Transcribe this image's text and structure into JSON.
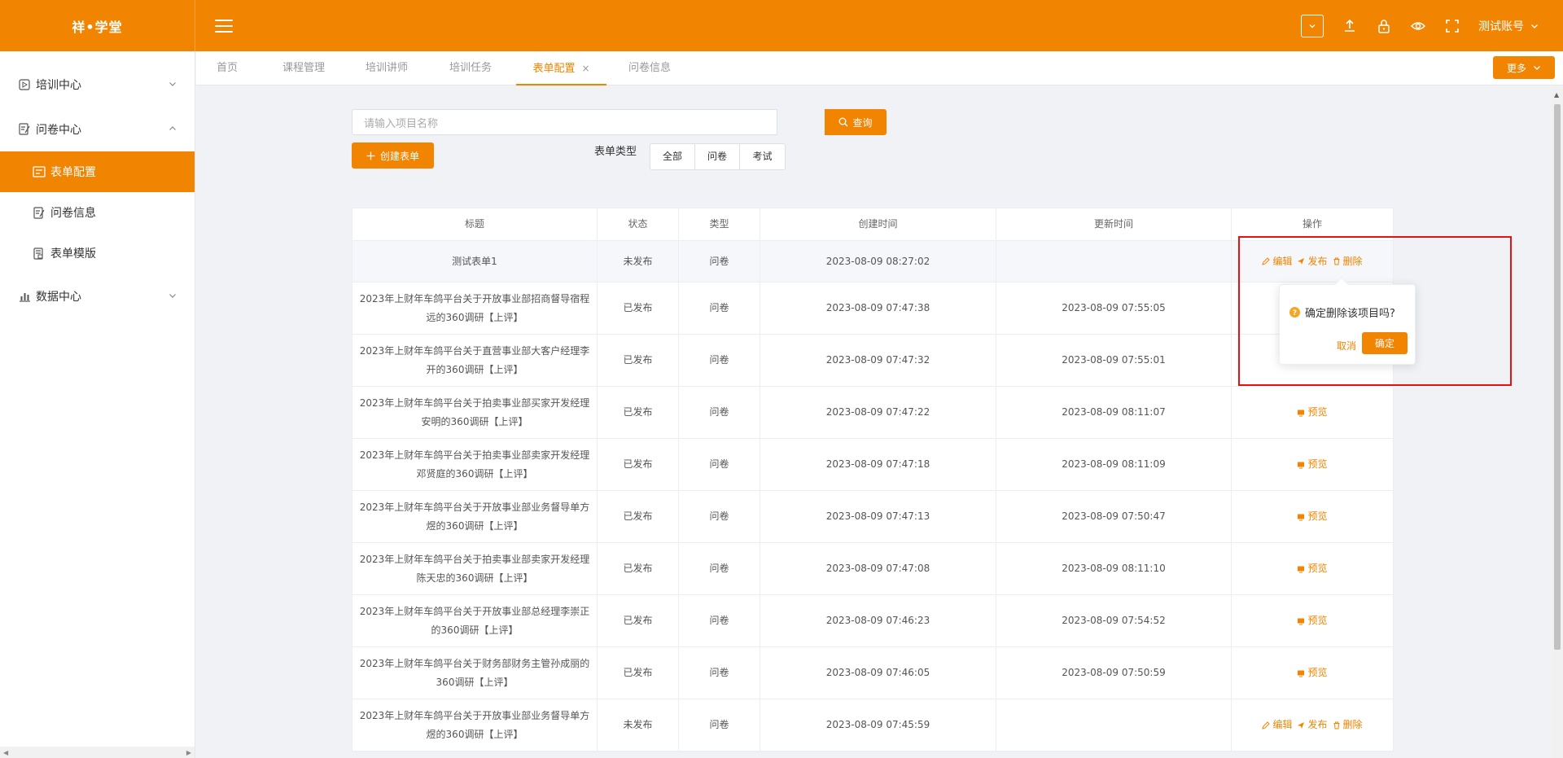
{
  "app": {
    "title": "祥•学堂"
  },
  "header": {
    "account_label": "测试账号"
  },
  "sidebar": {
    "groups": [
      {
        "label": "培训中心",
        "expanded": false
      },
      {
        "label": "问卷中心",
        "expanded": true
      },
      {
        "label": "数据中心",
        "expanded": false
      }
    ],
    "sub_items": [
      {
        "label": "表单配置",
        "active": true
      },
      {
        "label": "问卷信息",
        "active": false
      },
      {
        "label": "表单模版",
        "active": false
      }
    ]
  },
  "tabs": [
    {
      "label": "首页"
    },
    {
      "label": "课程管理"
    },
    {
      "label": "培训讲师"
    },
    {
      "label": "培训任务"
    },
    {
      "label": "表单配置",
      "active": true,
      "close": "×"
    },
    {
      "label": "问卷信息"
    }
  ],
  "more_button": {
    "label": "更多"
  },
  "search": {
    "placeholder": "请输入项目名称",
    "button_label": "查询"
  },
  "create_button": {
    "label": "创建表单"
  },
  "type_filter": {
    "label": "表单类型",
    "options": [
      "全部",
      "问卷",
      "考试"
    ]
  },
  "table": {
    "headers": [
      "标题",
      "状态",
      "类型",
      "创建时间",
      "更新时间",
      "操作"
    ],
    "rows": [
      {
        "title": "测试表单1",
        "status": "未发布",
        "type": "问卷",
        "created": "2023-08-09 08:27:02",
        "updated": "",
        "actions": [
          "编辑",
          "发布",
          "删除"
        ]
      },
      {
        "title": "2023年上财年车鸽平台关于开放事业部招商督导宿程远的360调研【上评】",
        "status": "已发布",
        "type": "问卷",
        "created": "2023-08-09 07:47:38",
        "updated": "2023-08-09 07:55:05",
        "actions": []
      },
      {
        "title": "2023年上财年车鸽平台关于直营事业部大客户经理李开的360调研【上评】",
        "status": "已发布",
        "type": "问卷",
        "created": "2023-08-09 07:47:32",
        "updated": "2023-08-09 07:55:01",
        "actions": []
      },
      {
        "title": "2023年上财年车鸽平台关于拍卖事业部买家开发经理安明的360调研【上评】",
        "status": "已发布",
        "type": "问卷",
        "created": "2023-08-09 07:47:22",
        "updated": "2023-08-09 08:11:07",
        "actions": [
          "预览"
        ]
      },
      {
        "title": "2023年上财年车鸽平台关于拍卖事业部卖家开发经理邓贤庭的360调研【上评】",
        "status": "已发布",
        "type": "问卷",
        "created": "2023-08-09 07:47:18",
        "updated": "2023-08-09 08:11:09",
        "actions": [
          "预览"
        ]
      },
      {
        "title": "2023年上财年车鸽平台关于开放事业部业务督导单方煜的360调研【上评】",
        "status": "已发布",
        "type": "问卷",
        "created": "2023-08-09 07:47:13",
        "updated": "2023-08-09 07:50:47",
        "actions": [
          "预览"
        ]
      },
      {
        "title": "2023年上财年车鸽平台关于拍卖事业部卖家开发经理陈天忠的360调研【上评】",
        "status": "已发布",
        "type": "问卷",
        "created": "2023-08-09 07:47:08",
        "updated": "2023-08-09 08:11:10",
        "actions": [
          "预览"
        ]
      },
      {
        "title": "2023年上财年车鸽平台关于开放事业部总经理李崇正的360调研【上评】",
        "status": "已发布",
        "type": "问卷",
        "created": "2023-08-09 07:46:23",
        "updated": "2023-08-09 07:54:52",
        "actions": [
          "预览"
        ]
      },
      {
        "title": "2023年上财年车鸽平台关于财务部财务主管孙成丽的360调研【上评】",
        "status": "已发布",
        "type": "问卷",
        "created": "2023-08-09 07:46:05",
        "updated": "2023-08-09 07:50:59",
        "actions": [
          "预览"
        ]
      },
      {
        "title": "2023年上财年车鸽平台关于开放事业部业务督导单方煜的360调研【上评】",
        "status": "未发布",
        "type": "问卷",
        "created": "2023-08-09 07:45:59",
        "updated": "",
        "actions": [
          "编辑",
          "发布",
          "删除"
        ]
      }
    ]
  },
  "popconfirm": {
    "message": "确定删除该项目吗?",
    "cancel_label": "取消",
    "confirm_label": "确定"
  },
  "colors": {
    "accent": "#f18400",
    "highlight": "#e81010"
  }
}
